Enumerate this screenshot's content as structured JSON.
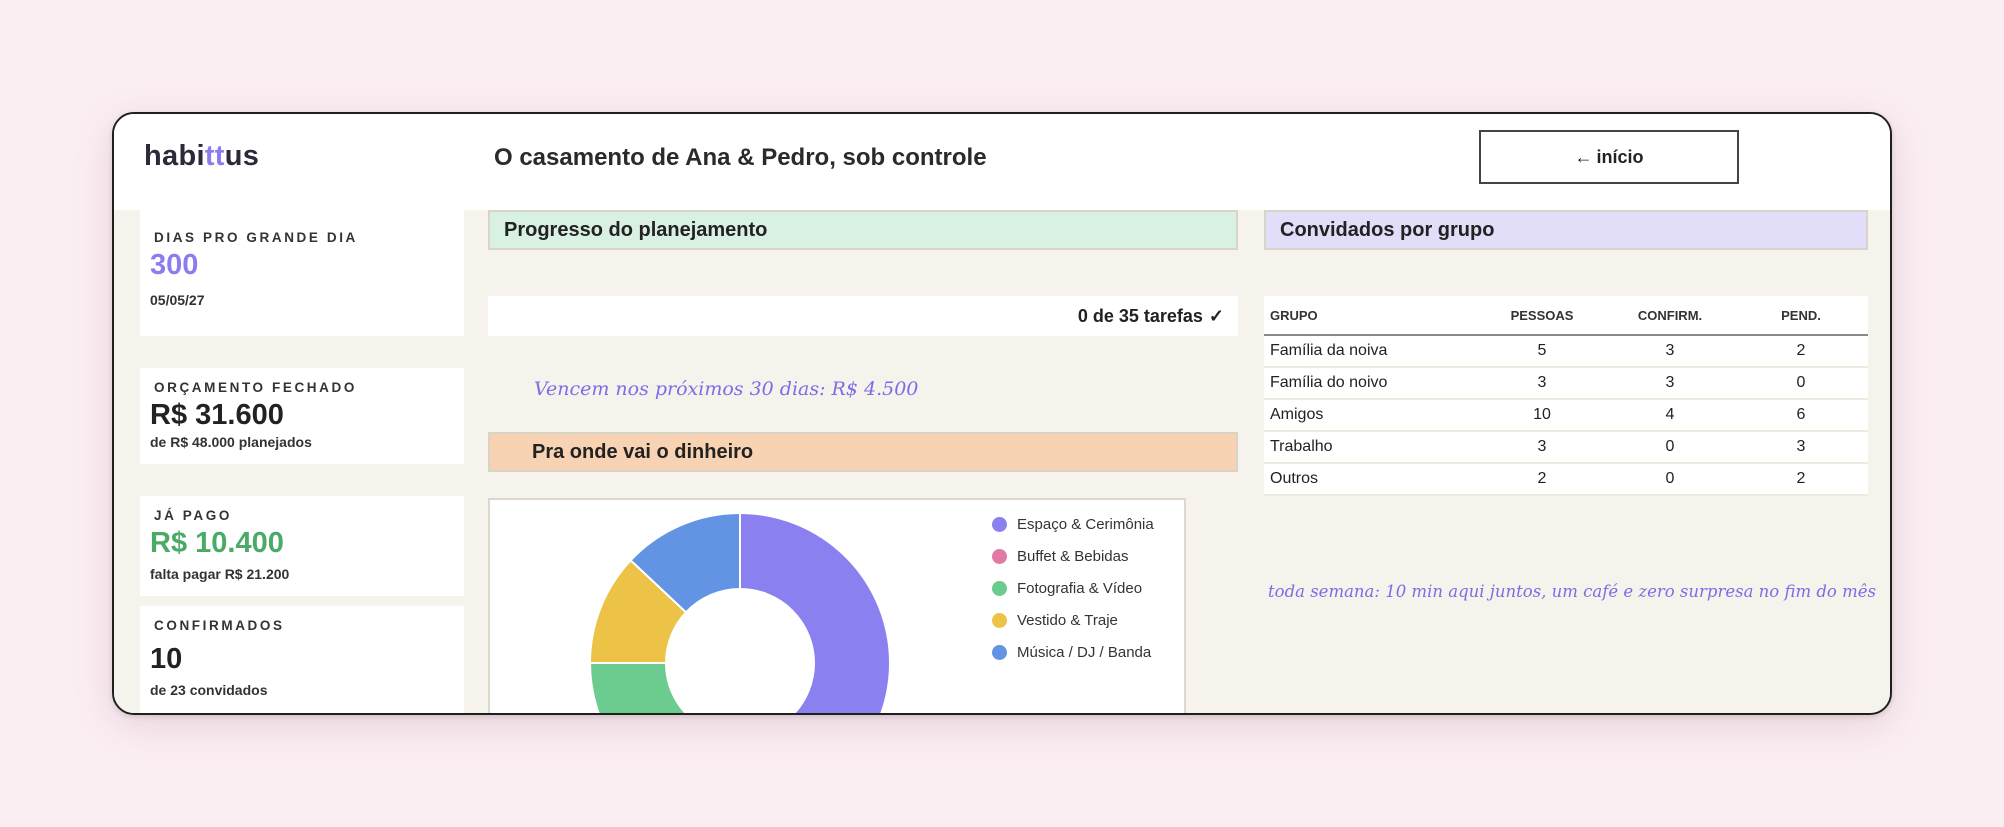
{
  "header": {
    "logo": "habittus",
    "logo_start": "habi",
    "logo_mid": "tt",
    "logo_end": "us",
    "title": "O casamento de Ana & Pedro, sob controle",
    "home_button": "inicio",
    "home_arrow": "←",
    "home_label": "início"
  },
  "kpis": {
    "days": {
      "label": "DIAS PRO GRANDE DIA",
      "value": "300",
      "sub": "05/05/27"
    },
    "budget": {
      "label": "ORÇAMENTO FECHADO",
      "value": "R$ 31.600",
      "sub": "de R$ 48.000 planejados"
    },
    "paid": {
      "label": "JÁ PAGO",
      "value": "R$ 10.400",
      "sub": "falta pagar R$ 21.200"
    },
    "confirmed": {
      "label": "CONFIRMADOS",
      "value": "10",
      "sub": "de 23 convidados"
    }
  },
  "planning": {
    "title": "Progresso do planejamento",
    "progress_text": "0 de 35 tarefas",
    "check": "✓",
    "due_note": "Vencem nos próximos 30 dias: R$ 4.500"
  },
  "money": {
    "title": "Pra onde vai o dinheiro"
  },
  "guests": {
    "title": "Convidados por grupo",
    "columns": [
      "GRUPO",
      "PESSOAS",
      "CONFIRM.",
      "PEND."
    ],
    "rows": [
      [
        "Família da noiva",
        "5",
        "3",
        "2"
      ],
      [
        "Família do noivo",
        "3",
        "3",
        "0"
      ],
      [
        "Amigos",
        "10",
        "4",
        "6"
      ],
      [
        "Trabalho",
        "3",
        "0",
        "3"
      ],
      [
        "Outros",
        "2",
        "0",
        "2"
      ]
    ],
    "note": "toda semana: 10 min aqui juntos, um café e zero surpresa no fim do mês"
  },
  "colors": {
    "accent": "#8b7cf0",
    "green": "#4caa68",
    "progress_header": "#d9f1e3",
    "money_header": "#f8d3b3",
    "guests_header": "#e2ddf8"
  },
  "chart_data": {
    "type": "pie",
    "style": "donut",
    "categories": [
      "Espaço & Cerimônia",
      "Buffet & Bebidas",
      "Fotografia & Vídeo",
      "Vestido & Traje",
      "Música / DJ / Banda"
    ],
    "values": [
      50,
      5,
      20,
      12,
      13
    ],
    "colors": [
      "#8b80f0",
      "#e079a3",
      "#6ccb8f",
      "#ecc346",
      "#6294e3"
    ],
    "legend_position": "right"
  }
}
